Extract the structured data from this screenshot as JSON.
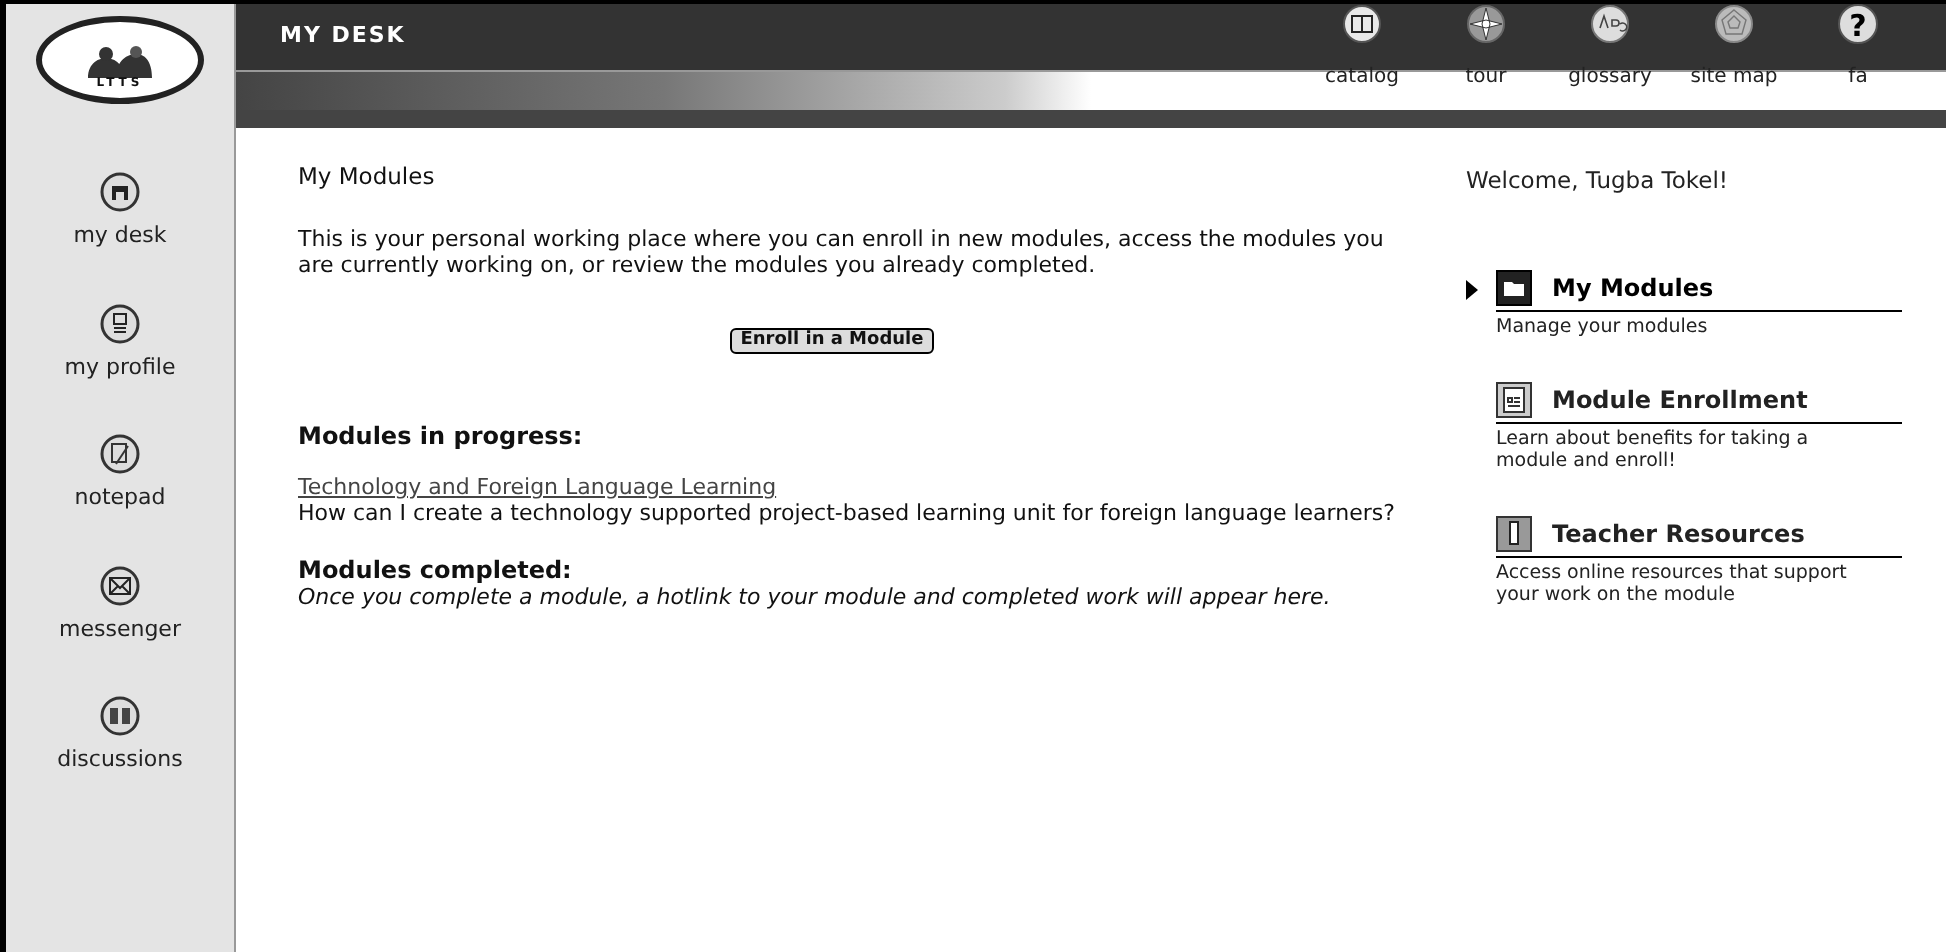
{
  "logo": {
    "text": "LTTS"
  },
  "header": {
    "title": "MY DESK"
  },
  "nav": [
    {
      "kind": "book",
      "label": "catalog"
    },
    {
      "kind": "compass",
      "label": "tour"
    },
    {
      "kind": "abc",
      "label": "glossary"
    },
    {
      "kind": "web",
      "label": "site map"
    },
    {
      "kind": "help",
      "label": "fa",
      "icon_text": "?"
    }
  ],
  "sidebar": [
    {
      "kind": "desk",
      "label": "my desk"
    },
    {
      "kind": "profile",
      "label": "my profile"
    },
    {
      "kind": "notepad",
      "label": "notepad"
    },
    {
      "kind": "envelope",
      "label": "messenger"
    },
    {
      "kind": "discussion",
      "label": "discussions"
    }
  ],
  "main": {
    "heading": "My Modules",
    "intro": "This is your personal working place where you can enroll in new modules, access the modules you are currently working on, or review the modules you already completed.",
    "button": "Enroll in a Module",
    "in_progress": {
      "heading": "Modules in progress:",
      "link": "Technology and Foreign Language Learning",
      "description": "How can I create a technology supported project-based learning unit for foreign language learners?"
    },
    "completed": {
      "heading": "Modules completed:",
      "note": "Once you complete a module, a hotlink to your module and completed work will appear here."
    }
  },
  "right": {
    "welcome": "Welcome, Tugba Tokel!",
    "items": [
      {
        "kind": "folder",
        "title": "My Modules",
        "description": "Manage your modules",
        "selected": true
      },
      {
        "kind": "form",
        "title": "Module Enrollment",
        "description": "Learn about benefits for taking a module and enroll!",
        "selected": false
      },
      {
        "kind": "pencil",
        "title": "Teacher Resources",
        "description": "Access online resources that support your work on the module",
        "selected": false
      }
    ]
  }
}
